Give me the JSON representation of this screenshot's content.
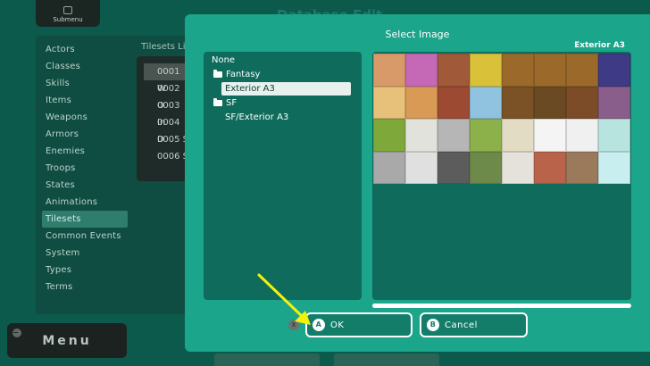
{
  "background": {
    "submenu_label": "Submenu",
    "submenu_icon": "square-button-icon",
    "title": "Database Edit",
    "tilesets_label": "Tilesets Lis",
    "categories": [
      "Actors",
      "Classes",
      "Skills",
      "Items",
      "Weapons",
      "Armors",
      "Enemies",
      "Troops",
      "States",
      "Animations",
      "Tilesets",
      "Common Events",
      "System",
      "Types",
      "Terms"
    ],
    "active_category_index": 10,
    "tileset_entries": [
      "0001 W",
      "0002 O",
      "0003 In",
      "0004 D",
      "0005 S",
      "0006 S"
    ],
    "menu_label": "Menu"
  },
  "dialog": {
    "title": "Select Image",
    "preview_name": "Exterior A3",
    "tree": [
      {
        "label": "None",
        "type": "item",
        "level": 0
      },
      {
        "label": "Fantasy",
        "type": "folder",
        "level": 0
      },
      {
        "label": "Exterior A3",
        "type": "item",
        "level": 1,
        "selected": true
      },
      {
        "label": "SF",
        "type": "folder",
        "level": 0
      },
      {
        "label": "SF/Exterior A3",
        "type": "item",
        "level": 1
      }
    ],
    "ok": {
      "key": "A",
      "label": "OK"
    },
    "cancel": {
      "key": "B",
      "label": "Cancel"
    },
    "close_key": "X"
  },
  "colors": {
    "dialog_bg": "#1ba58a",
    "panel_bg": "#0f6b5b",
    "page_bg": "#0b5a4c",
    "pointer": "#f2f20a"
  },
  "tiles": [
    "#d99a6a",
    "#c569b6",
    "#a05a3a",
    "#d9c13a",
    "#9b6a2a",
    "#9b6a2a",
    "#9b6a2a",
    "#3e3a86",
    "#e7c079",
    "#d89a55",
    "#9d4a32",
    "#8fc3e0",
    "#7a5226",
    "#6a4a22",
    "#7c4c28",
    "#8a5e8a",
    "#7fa83b",
    "#e2e2dc",
    "#b6b6b6",
    "#8cb14a",
    "#e2dcc4",
    "#f4f4f4",
    "#f0f0f0",
    "#b8e4e0",
    "#a9a9a9",
    "#e0e0e0",
    "#5c5c5c",
    "#6e8a4a",
    "#e4e2da",
    "#b9644a",
    "#9a7a5a",
    "#c8eef0"
  ]
}
